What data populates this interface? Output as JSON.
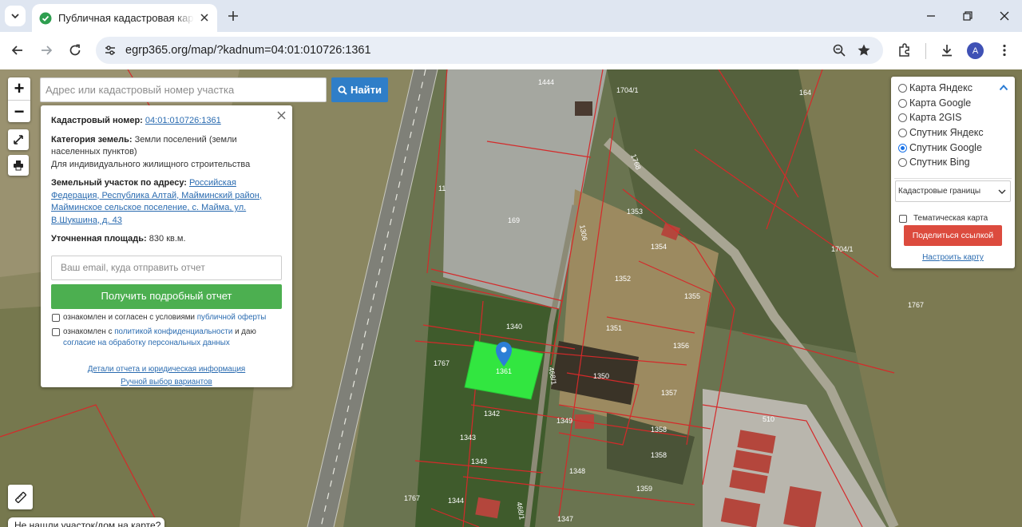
{
  "browser": {
    "tab_title": "Публичная кадастровая карта",
    "url": "egrp365.org/map/?kadnum=04:01:010726:1361",
    "profile_initial": "A"
  },
  "map": {
    "search_placeholder": "Адрес или кадастровый номер участка",
    "search_button": "Найти",
    "zoom_in": "+",
    "zoom_out": "−",
    "bottom_hint": "Не нашли участок/дом на карте?",
    "selected_parcel_color": "#32e640",
    "boundary_color": "#d42a2a",
    "parcel_labels": [
      "1444",
      "1704/1",
      "164",
      "1767",
      "169",
      "11",
      "1353",
      "1354",
      "1352",
      "1355",
      "1351",
      "1356",
      "1350",
      "1357",
      "1349",
      "1358",
      "1358",
      "1359",
      "1348",
      "1340",
      "1342",
      "1343",
      "1343",
      "1344",
      "1347",
      "1704/1",
      "510",
      "1767",
      "1361",
      "1767",
      "1768",
      "1306",
      "468/1",
      "468/1"
    ]
  },
  "info_panel": {
    "cad_number_label": "Кадастровый номер:",
    "cad_number_value": "04:01:010726:1361",
    "category_label": "Категория земель:",
    "category_value": "Земли поселений (земли населенных пунктов)",
    "usage": "Для индивидуального жилищного строительства",
    "address_label": "Земельный участок по адресу:",
    "address_value": "Российская Федерация, Республика Алтай, Майминский район, Майминское сельское поселение, с. Майма, ул. В.Шукшина, д. 43",
    "area_label": "Уточненная площадь:",
    "area_value": "830 кв.м.",
    "email_placeholder": "Ваш email, куда отправить отчет",
    "report_button": "Получить подробный отчет",
    "consent1_text": "ознакомлен и согласен с условиями",
    "consent1_link": "публичной оферты",
    "consent2_text": "ознакомлен с",
    "consent2_link1": "политикой конфиденциальности",
    "consent2_mid": "и даю",
    "consent2_link2": "согласие на обработку персональных данных",
    "details_link": "Детали отчета и юридическая информация",
    "manual_link": "Ручной выбор вариантов"
  },
  "layers_panel": {
    "options": [
      "Карта Яндекс",
      "Карта Google",
      "Карта 2GIS",
      "Спутник Яндекс",
      "Спутник Google",
      "Спутник Bing"
    ],
    "selected": "Спутник Google",
    "overlay_select": "Кадастровые границы",
    "thematic_label": "Тематическая карта",
    "share_button": "Поделиться ссылкой",
    "setup_link": "Настроить карту"
  }
}
